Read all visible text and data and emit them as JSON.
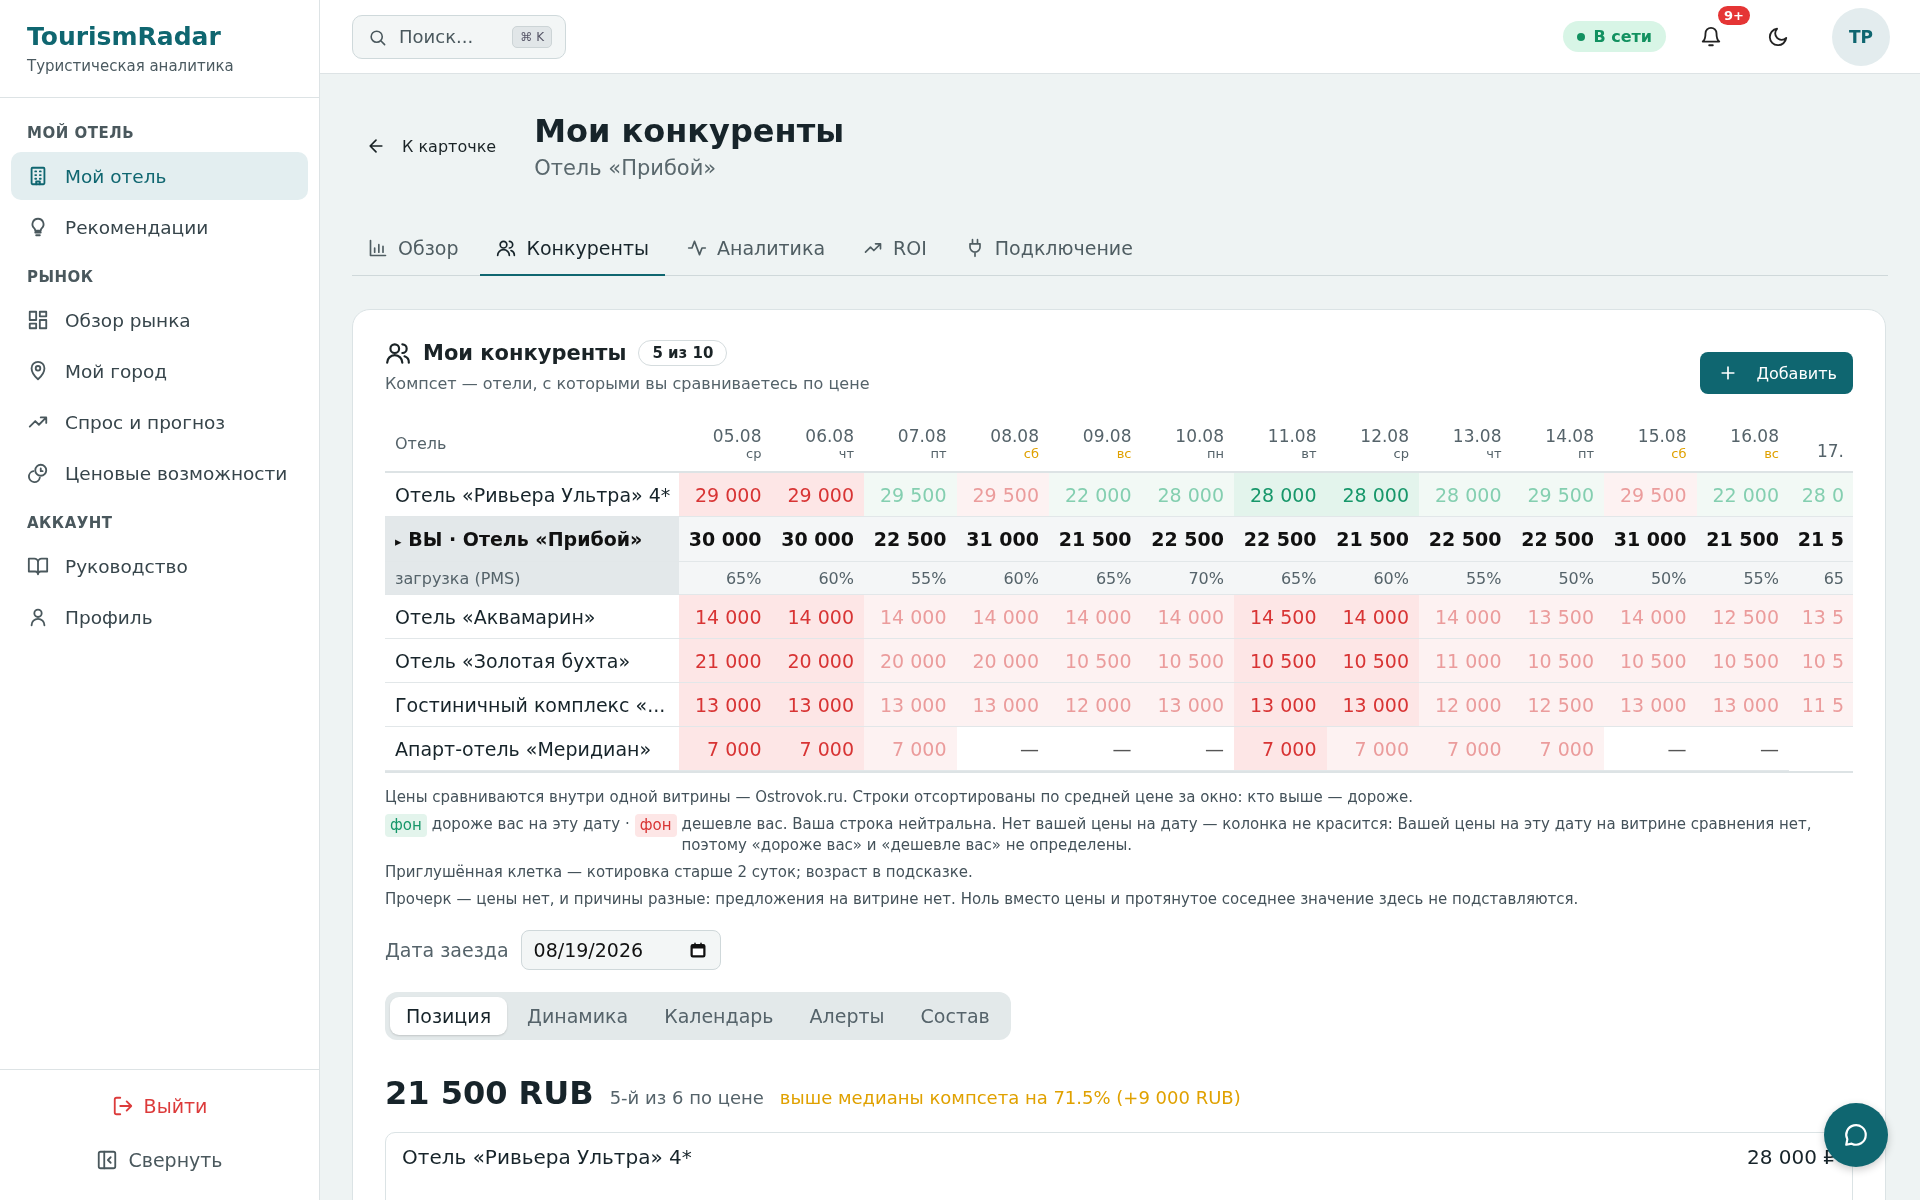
{
  "sidebar": {
    "brand": "TourismRadar",
    "tagline": "Туристическая аналитика",
    "sections": [
      {
        "title": "МОЙ ОТЕЛЬ",
        "items": [
          {
            "label": "Мой отель",
            "selected": true
          },
          {
            "label": "Рекомендации",
            "selected": false
          }
        ]
      },
      {
        "title": "РЫНОК",
        "items": [
          {
            "label": "Обзор рынка",
            "selected": false
          },
          {
            "label": "Мой город",
            "selected": false
          },
          {
            "label": "Спрос и прогноз",
            "selected": false
          },
          {
            "label": "Ценовые возможности",
            "selected": false
          }
        ]
      },
      {
        "title": "АККАУНТ",
        "items": [
          {
            "label": "Руководство",
            "selected": false
          },
          {
            "label": "Профиль",
            "selected": false
          }
        ]
      }
    ],
    "logout": "Выйти",
    "collapse": "Свернуть"
  },
  "topbar": {
    "search": {
      "placeholder": "Поиск..."
    },
    "shortcut": "⌘ K",
    "status": "В сети",
    "notifications": "9+",
    "avatar": "ТР"
  },
  "header": {
    "back": "К карточке",
    "title": "Мои конкуренты",
    "subtitle": "Отель «Прибой»"
  },
  "tabs": [
    {
      "label": "Обзор",
      "selected": false
    },
    {
      "label": "Конкуренты",
      "selected": true
    },
    {
      "label": "Аналитика",
      "selected": false
    },
    {
      "label": "ROI",
      "selected": false
    },
    {
      "label": "Подключение",
      "selected": false
    }
  ],
  "compset": {
    "title": "Мои конкуренты",
    "count": "5 из 10",
    "subtitle": "Компсет — отели, с которыми вы сравниваетесь по цене",
    "add_button": "Добавить",
    "table": {
      "name_header": "Отель",
      "columns": [
        {
          "date": "05.08",
          "weekday": "ср",
          "weekend": false
        },
        {
          "date": "06.08",
          "weekday": "чт",
          "weekend": false
        },
        {
          "date": "07.08",
          "weekday": "пт",
          "weekend": false
        },
        {
          "date": "08.08",
          "weekday": "сб",
          "weekend": true
        },
        {
          "date": "09.08",
          "weekday": "вс",
          "weekend": true
        },
        {
          "date": "10.08",
          "weekday": "пн",
          "weekend": false
        },
        {
          "date": "11.08",
          "weekday": "вт",
          "weekend": false
        },
        {
          "date": "12.08",
          "weekday": "ср",
          "weekend": false
        },
        {
          "date": "13.08",
          "weekday": "чт",
          "weekend": false
        },
        {
          "date": "14.08",
          "weekday": "пт",
          "weekend": false
        },
        {
          "date": "15.08",
          "weekday": "сб",
          "weekend": true
        },
        {
          "date": "16.08",
          "weekday": "вс",
          "weekend": true
        },
        {
          "date": "17."
        }
      ],
      "rows": [
        {
          "kind": "competitor",
          "name": "Отель «Ривьера Ультра» 4*",
          "cells": [
            {
              "value": "29 000",
              "kind": "cheaper",
              "stale": false
            },
            {
              "value": "29 000",
              "kind": "cheaper",
              "stale": false
            },
            {
              "value": "29 500",
              "kind": "dearer",
              "stale": true
            },
            {
              "value": "29 500",
              "kind": "cheaper",
              "stale": true
            },
            {
              "value": "22 000",
              "kind": "dearer",
              "stale": true
            },
            {
              "value": "28 000",
              "kind": "dearer",
              "stale": true
            },
            {
              "value": "28 000",
              "kind": "dearer",
              "stale": false
            },
            {
              "value": "28 000",
              "kind": "dearer",
              "stale": false
            },
            {
              "value": "28 000",
              "kind": "dearer",
              "stale": true
            },
            {
              "value": "29 500",
              "kind": "dearer",
              "stale": true
            },
            {
              "value": "29 500",
              "kind": "cheaper",
              "stale": true
            },
            {
              "value": "22 000",
              "kind": "dearer",
              "stale": true
            },
            {
              "value": "28 0",
              "kind": "dearer",
              "stale": true
            }
          ]
        },
        {
          "kind": "you",
          "marker": "▸",
          "name": "ВЫ · Отель «Прибой»",
          "cells": [
            "30 000",
            "30 000",
            "22 500",
            "31 000",
            "21 500",
            "22 500",
            "22 500",
            "21 500",
            "22 500",
            "22 500",
            "31 000",
            "21 500",
            "21 5"
          ]
        },
        {
          "kind": "occupancy",
          "name": "загрузка (PMS)",
          "cells": [
            "65%",
            "60%",
            "55%",
            "60%",
            "65%",
            "70%",
            "65%",
            "60%",
            "55%",
            "50%",
            "50%",
            "55%",
            "65"
          ]
        },
        {
          "kind": "competitor",
          "name": "Отель «Аквамарин»",
          "cells": [
            {
              "value": "14 000",
              "kind": "cheaper",
              "stale": false
            },
            {
              "value": "14 000",
              "kind": "cheaper",
              "stale": false
            },
            {
              "value": "14 000",
              "kind": "cheaper",
              "stale": true
            },
            {
              "value": "14 000",
              "kind": "cheaper",
              "stale": true
            },
            {
              "value": "14 000",
              "kind": "cheaper",
              "stale": true
            },
            {
              "value": "14 000",
              "kind": "cheaper",
              "stale": true
            },
            {
              "value": "14 500",
              "kind": "cheaper",
              "stale": false
            },
            {
              "value": "14 000",
              "kind": "cheaper",
              "stale": false
            },
            {
              "value": "14 000",
              "kind": "cheaper",
              "stale": true
            },
            {
              "value": "13 500",
              "kind": "cheaper",
              "stale": true
            },
            {
              "value": "14 000",
              "kind": "cheaper",
              "stale": true
            },
            {
              "value": "12 500",
              "kind": "cheaper",
              "stale": true
            },
            {
              "value": "13 5",
              "kind": "cheaper",
              "stale": true
            }
          ]
        },
        {
          "kind": "competitor",
          "name": "Отель «Золотая бухта»",
          "cells": [
            {
              "value": "21 000",
              "kind": "cheaper",
              "stale": false
            },
            {
              "value": "20 000",
              "kind": "cheaper",
              "stale": false
            },
            {
              "value": "20 000",
              "kind": "cheaper",
              "stale": true
            },
            {
              "value": "20 000",
              "kind": "cheaper",
              "stale": true
            },
            {
              "value": "10 500",
              "kind": "cheaper",
              "stale": true
            },
            {
              "value": "10 500",
              "kind": "cheaper",
              "stale": true
            },
            {
              "value": "10 500",
              "kind": "cheaper",
              "stale": false
            },
            {
              "value": "10 500",
              "kind": "cheaper",
              "stale": false
            },
            {
              "value": "11 000",
              "kind": "cheaper",
              "stale": true
            },
            {
              "value": "10 500",
              "kind": "cheaper",
              "stale": true
            },
            {
              "value": "10 500",
              "kind": "cheaper",
              "stale": true
            },
            {
              "value": "10 500",
              "kind": "cheaper",
              "stale": true
            },
            {
              "value": "10 5",
              "kind": "cheaper",
              "stale": true
            }
          ]
        },
        {
          "kind": "competitor",
          "name": "Гостиничный комплекс «...",
          "cells": [
            {
              "value": "13 000",
              "kind": "cheaper",
              "stale": false
            },
            {
              "value": "13 000",
              "kind": "cheaper",
              "stale": false
            },
            {
              "value": "13 000",
              "kind": "cheaper",
              "stale": true
            },
            {
              "value": "13 000",
              "kind": "cheaper",
              "stale": true
            },
            {
              "value": "12 000",
              "kind": "cheaper",
              "stale": true
            },
            {
              "value": "13 000",
              "kind": "cheaper",
              "stale": true
            },
            {
              "value": "13 000",
              "kind": "cheaper",
              "stale": false
            },
            {
              "value": "13 000",
              "kind": "cheaper",
              "stale": false
            },
            {
              "value": "12 000",
              "kind": "cheaper",
              "stale": true
            },
            {
              "value": "12 500",
              "kind": "cheaper",
              "stale": true
            },
            {
              "value": "13 000",
              "kind": "cheaper",
              "stale": true
            },
            {
              "value": "13 000",
              "kind": "cheaper",
              "stale": true
            },
            {
              "value": "11 5",
              "kind": "cheaper",
              "stale": true
            }
          ]
        },
        {
          "kind": "competitor",
          "name": "Апарт-отель «Меридиан»",
          "cells": [
            {
              "value": "7 000",
              "kind": "cheaper",
              "stale": false
            },
            {
              "value": "7 000",
              "kind": "cheaper",
              "stale": false
            },
            {
              "value": "7 000",
              "kind": "cheaper",
              "stale": true
            },
            {
              "value": "—",
              "kind": "none"
            },
            {
              "value": "—",
              "kind": "none"
            },
            {
              "value": "—",
              "kind": "none"
            },
            {
              "value": "7 000",
              "kind": "cheaper",
              "stale": false
            },
            {
              "value": "7 000",
              "kind": "cheaper",
              "stale": true
            },
            {
              "value": "7 000",
              "kind": "cheaper",
              "stale": true
            },
            {
              "value": "7 000",
              "kind": "cheaper",
              "stale": true
            },
            {
              "value": "—",
              "kind": "none"
            },
            {
              "value": "—",
              "kind": "none"
            }
          ]
        }
      ]
    }
  },
  "notes": {
    "intro": "Цены сравниваются внутри одной витрины — Ostrovok.ru. Строки отсортированы по средней цене за окно: кто выше — дороже.",
    "legend": [
      {
        "chip": "фон",
        "kind": "dearer",
        "text": "дороже вас на эту дату ·"
      },
      {
        "chip": "фон",
        "kind": "cheaper",
        "text": "дешевле вас. Ваша строка нейтральна. Нет вашей цены на дату — колонка не красится: Вашей цены на эту дату на витрине сравнения нет, поэтому «дороже вас» и «дешевле вас» не определены."
      }
    ],
    "stale": "Приглушённая клетка — котировка старше 2 суток; возраст в подсказке.",
    "dash": "Прочерк — цены нет, и причины разные: предложения на витрине нет. Ноль вместо цены и протянутое соседнее значение здесь не подставляются."
  },
  "checkin": {
    "label": "Дата заезда",
    "value": "08/19/2026"
  },
  "subtabs": [
    {
      "label": "Позиция",
      "selected": true
    },
    {
      "label": "Динамика",
      "selected": false
    },
    {
      "label": "Календарь",
      "selected": false
    },
    {
      "label": "Алерты",
      "selected": false
    },
    {
      "label": "Состав",
      "selected": false
    }
  ],
  "position": {
    "price": "21 500 RUB",
    "rank": "5-й из 6 по цене",
    "delta": "выше медианы компсета на 71.5% (+9 000 RUB)",
    "hotels": [
      {
        "name": "Отель «Ривьера Ультра» 4*",
        "price": "28 000 ₽"
      }
    ]
  }
}
